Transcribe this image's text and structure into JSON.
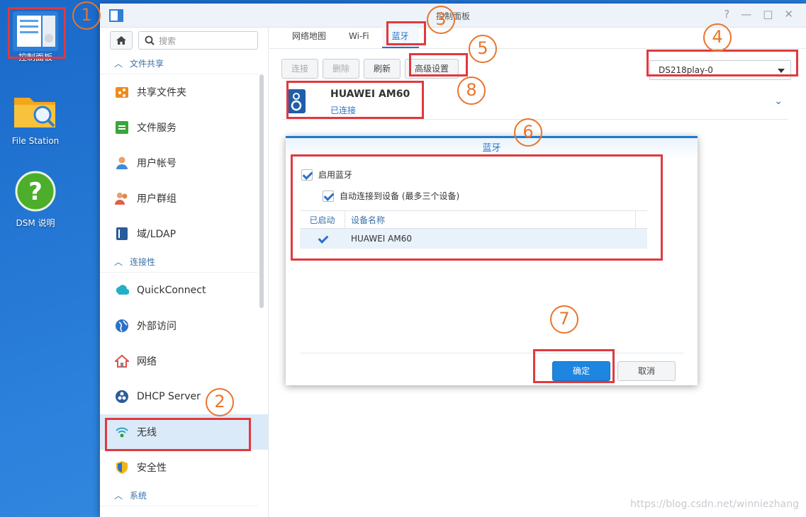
{
  "desktop": {
    "icons": [
      {
        "label": "控制面板",
        "icon": "control-panel-icon"
      },
      {
        "label": "File Station",
        "icon": "folder-search-icon"
      },
      {
        "label": "DSM 说明",
        "icon": "help-icon"
      }
    ]
  },
  "window": {
    "title": "控制面板"
  },
  "sidebar": {
    "search_placeholder": "搜索",
    "sections": [
      {
        "title": "文件共享",
        "items": [
          "共享文件夹",
          "文件服务",
          "用户帐号",
          "用户群组",
          "域/LDAP"
        ]
      },
      {
        "title": "连接性",
        "items": [
          "QuickConnect",
          "外部访问",
          "网络",
          "DHCP Server",
          "无线",
          "安全性"
        ]
      },
      {
        "title": "系统",
        "items": []
      }
    ],
    "active_item": "无线"
  },
  "tabs": [
    "网络地图",
    "Wi-Fi",
    "蓝牙"
  ],
  "selected_tab": "蓝牙",
  "toolbar": {
    "connect": "连接",
    "delete": "删除",
    "refresh": "刷新",
    "advanced": "高级设置"
  },
  "device_select": {
    "value": "DS218play-0"
  },
  "device": {
    "name": "HUAWEI AM60",
    "status": "已连接"
  },
  "dialog": {
    "title": "蓝牙",
    "enable_bluetooth": "启用蓝牙",
    "auto_connect": "自动连接到设备 (最多三个设备)",
    "columns": [
      "已启动",
      "设备名称"
    ],
    "rows": [
      {
        "enabled": true,
        "name": "HUAWEI AM60"
      }
    ],
    "ok": "确定",
    "cancel": "取消"
  },
  "annotations": [
    "1",
    "2",
    "3",
    "4",
    "5",
    "6",
    "7",
    "8"
  ],
  "watermark": "https://blog.csdn.net/winniezhang",
  "colors": {
    "accent": "#2a72c8",
    "annotation_box": "#e0393e",
    "annotation_circle": "#e9742c",
    "primary_button": "#1e86e0"
  }
}
